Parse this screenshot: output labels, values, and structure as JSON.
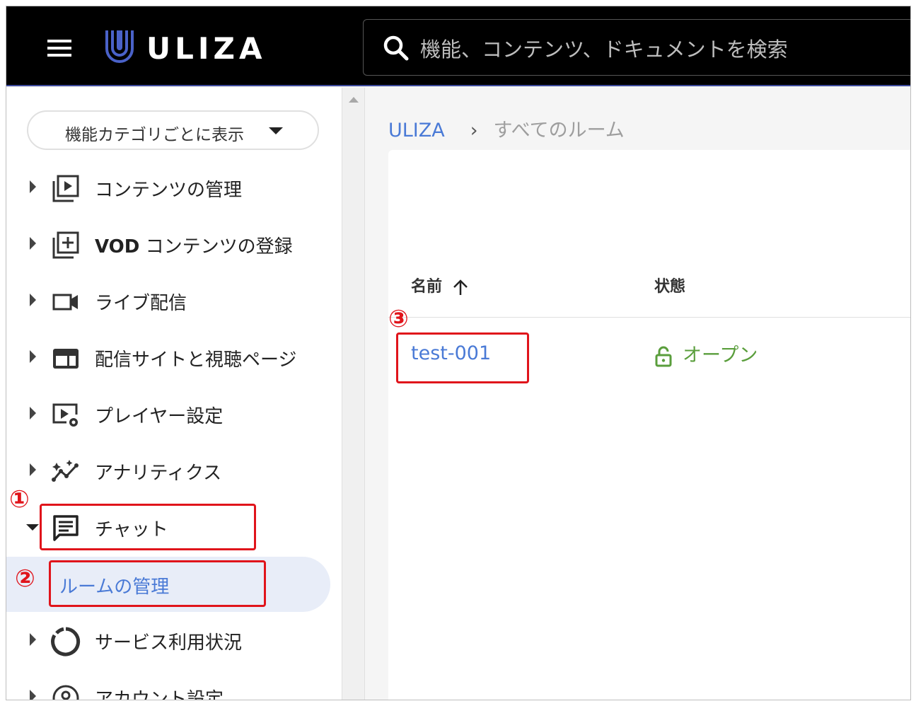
{
  "header": {
    "logo_text": "ULIZA",
    "search_placeholder": "機能、コンテンツ、ドキュメントを検索"
  },
  "sidebar": {
    "category_button": "機能カテゴリごとに表示",
    "items": [
      {
        "label": "コンテンツの管理",
        "icon": "video-library-icon"
      },
      {
        "label_bold": "VOD",
        "label": " コンテンツの登録",
        "icon": "add-library-icon"
      },
      {
        "label": "ライブ配信",
        "icon": "video-camera-icon"
      },
      {
        "label": "配信サイトと視聴ページ",
        "icon": "web-layout-icon"
      },
      {
        "label": "プレイヤー設定",
        "icon": "player-settings-icon"
      },
      {
        "label": "アナリティクス",
        "icon": "analytics-icon"
      },
      {
        "label": "チャット",
        "icon": "chat-icon",
        "expanded": true
      },
      {
        "label": "サービス利用状況",
        "icon": "donut-chart-icon"
      },
      {
        "label": "アカウント設定",
        "icon": "account-icon"
      }
    ],
    "sub_item": {
      "label": "ルームの管理",
      "selected": true
    }
  },
  "breadcrumb": {
    "root": "ULIZA",
    "separator": "›",
    "current": "すべてのルーム"
  },
  "table": {
    "columns": [
      "名前",
      "状態"
    ],
    "sort": "ascending",
    "rows": [
      {
        "name": "test-001",
        "status": "オープン"
      }
    ]
  },
  "annotations": [
    "①",
    "②",
    "③"
  ],
  "colors": {
    "accent": "#4a7ad6",
    "status_open": "#5a9e3c",
    "annotation": "#e0141b",
    "selected_bg": "#e8edf8"
  }
}
